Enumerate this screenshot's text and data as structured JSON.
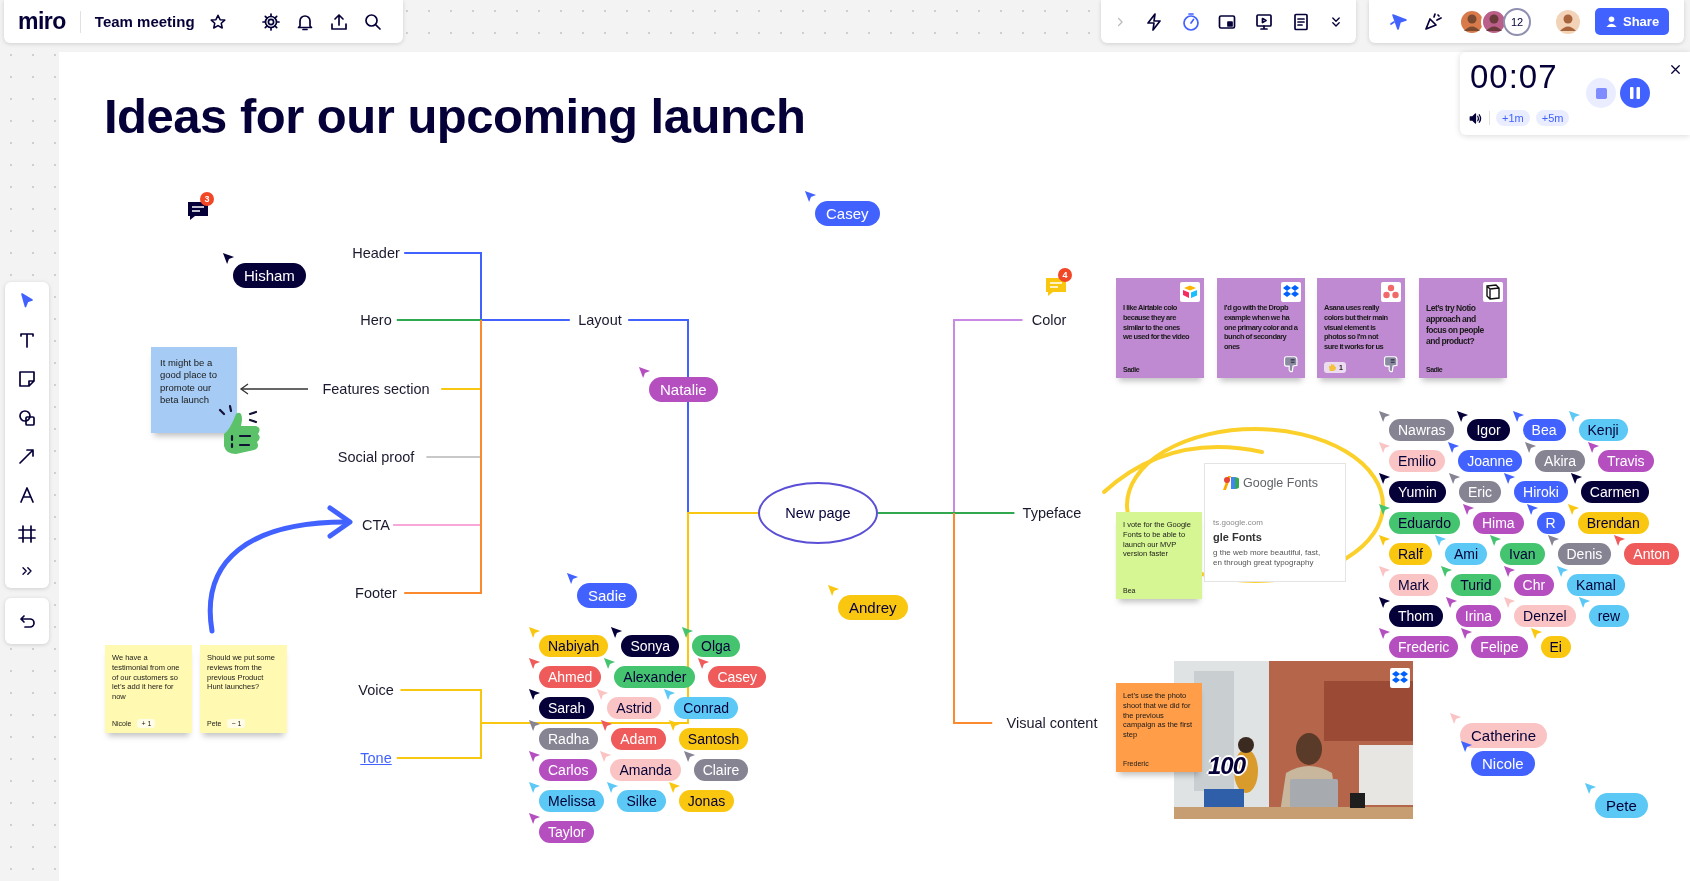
{
  "topbar": {
    "logo": "miro",
    "board_title": "Team meeting",
    "collaborator_count": "12",
    "share_label": "Share"
  },
  "timer": {
    "time": "00:07",
    "add_buttons": [
      "+1m",
      "+5m"
    ]
  },
  "board": {
    "title": "Ideas for our upcoming launch"
  },
  "mind_map": {
    "root": "New page",
    "children": [
      {
        "label": "Layout",
        "color": "#4262ff",
        "kind": "text",
        "children": [
          {
            "label": "Header",
            "color": "#4262ff"
          },
          {
            "label": "Hero",
            "color": "#2fa84f"
          },
          {
            "label": "Features section",
            "color": "#fac710"
          },
          {
            "label": "Social proof",
            "color": "#c8c8c8"
          },
          {
            "label": "CTA",
            "color": "#f7a8d8"
          },
          {
            "label": "Footer",
            "color": "#fa8a2d"
          }
        ]
      },
      {
        "label": "Voice",
        "color": "#fac710",
        "kind": "text"
      },
      {
        "label": "Tone",
        "color": "#fac710",
        "kind": "link"
      },
      {
        "label": "Color",
        "color": "#c98ae6",
        "kind": "text"
      },
      {
        "label": "Typeface",
        "color": "#2fa84f",
        "kind": "text"
      },
      {
        "label": "Visual content",
        "color": "#fa8a2d",
        "kind": "text"
      }
    ]
  },
  "comments": [
    {
      "count": "3",
      "color": "#050038"
    },
    {
      "count": "4",
      "color": "#fac710"
    }
  ],
  "sticky_notes": [
    {
      "text": "It might be a good place to promote our beta launch",
      "color": "#a6ccf5"
    },
    {
      "text": "We have a testimonial from one of our customers so let’s add it here for now",
      "author": "Nicole",
      "color": "#fff9b1",
      "reaction": {
        "kind": "vote",
        "sign": "+",
        "count": "1"
      }
    },
    {
      "text": "Should we put some reviews from the previous Product Hunt launches?",
      "author": "Pete",
      "color": "#fff9b1",
      "reaction": {
        "kind": "vote",
        "sign": "−",
        "count": "1"
      }
    },
    {
      "text": "I like Airtable colo\nbecause they are\nsimilar to the ones\nwe used for the video",
      "author": "Sadie",
      "color": "#c08ad2"
    },
    {
      "text": "I’d go with the Dropb\nexample when we ha\none primary color and a\nbunch of secondary ones",
      "color": "#c08ad2"
    },
    {
      "text": "Asana uses really\ncolors but their main\nvisual element is\nphotos so I’m not\nsure it works for us",
      "color": "#c08ad2",
      "reaction": {
        "kind": "emoji",
        "count": "1"
      }
    },
    {
      "text": "Let’s try Notio\napproach and\nfocus on people\nand product?",
      "author": "Sadie",
      "color": "#c08ad2"
    },
    {
      "text": "I vote for the Google Fonts to be able to launch our MVP version faster",
      "author": "Bea",
      "color": "#d5f692"
    },
    {
      "text": "Let’s use the photo shoot that we did for the previous campaign as the first step",
      "author": "Frederic",
      "color": "#ff9d48"
    }
  ],
  "link_preview": {
    "brand": "Google Fonts",
    "url": "ts.google.com",
    "title": "gle Fonts",
    "description": "g the web more beautiful, fast,\nen through great typography"
  },
  "photo": {
    "kind": "picture",
    "sticker": "100"
  },
  "cursors": [
    {
      "name": "Hisham",
      "color": "#050038"
    },
    {
      "name": "Casey",
      "color": "#4262ff"
    },
    {
      "name": "Natalie",
      "color": "#b54fc0"
    },
    {
      "name": "Sadie",
      "color": "#4262ff"
    },
    {
      "name": "Andrey",
      "color": "#fac710"
    },
    {
      "name": "Catherine",
      "color": "#fbc4c4"
    },
    {
      "name": "Nicole",
      "color": "#4262ff"
    },
    {
      "name": "Pete",
      "color": "#5bc8f5"
    }
  ],
  "cursor_clusters": [
    {
      "cursors": [
        {
          "name": "Nabiyah",
          "color": "#fac710"
        },
        {
          "name": "Sonya",
          "color": "#050038"
        },
        {
          "name": "Olga",
          "color": "#45c46f"
        },
        {
          "name": "Ahmed",
          "color": "#ef5b5b"
        },
        {
          "name": "Alexander",
          "color": "#45c46f"
        },
        {
          "name": "Casey",
          "color": "#ef5b5b"
        },
        {
          "name": "Sarah",
          "color": "#050038"
        },
        {
          "name": "Astrid",
          "color": "#fbc4c4"
        },
        {
          "name": "Conrad",
          "color": "#5bc8f5"
        },
        {
          "name": "Radha",
          "color": "#868393"
        },
        {
          "name": "Adam",
          "color": "#ef5b5b"
        },
        {
          "name": "Santosh",
          "color": "#fac710"
        },
        {
          "name": "Carlos",
          "color": "#b54fc0"
        },
        {
          "name": "Amanda",
          "color": "#fbc4c4"
        },
        {
          "name": "Claire",
          "color": "#868393"
        },
        {
          "name": "Melissa",
          "color": "#5bc8f5"
        },
        {
          "name": "Silke",
          "color": "#5bc8f5"
        },
        {
          "name": "Jonas",
          "color": "#fac710"
        },
        {
          "name": "Taylor",
          "color": "#b54fc0"
        }
      ]
    },
    {
      "cursors": [
        {
          "name": "Nawras",
          "color": "#868393"
        },
        {
          "name": "Igor",
          "color": "#050038"
        },
        {
          "name": "Bea",
          "color": "#4262ff"
        },
        {
          "name": "Kenji",
          "color": "#5bc8f5"
        },
        {
          "name": "Emilio",
          "color": "#fbc4c4"
        },
        {
          "name": "Joanne",
          "color": "#4262ff"
        },
        {
          "name": "Akira",
          "color": "#868393"
        },
        {
          "name": "Travis",
          "color": "#b54fc0"
        },
        {
          "name": "Yumin",
          "color": "#050038"
        },
        {
          "name": "Eric",
          "color": "#868393"
        },
        {
          "name": "Hiroki",
          "color": "#4262ff"
        },
        {
          "name": "Carmen",
          "color": "#050038"
        },
        {
          "name": "Eduardo",
          "color": "#45c46f"
        },
        {
          "name": "Hima",
          "color": "#b54fc0"
        },
        {
          "name": "R",
          "color": "#4262ff"
        },
        {
          "name": "Brendan",
          "color": "#fac710"
        },
        {
          "name": "Ralf",
          "color": "#fac710"
        },
        {
          "name": "Ami",
          "color": "#5bc8f5"
        },
        {
          "name": "Ivan",
          "color": "#45c46f"
        },
        {
          "name": "Denis",
          "color": "#868393"
        },
        {
          "name": "Anton",
          "color": "#ef5b5b"
        },
        {
          "name": "Mark",
          "color": "#fbc4c4"
        },
        {
          "name": "Turid",
          "color": "#45c46f"
        },
        {
          "name": "Chr",
          "color": "#b54fc0"
        },
        {
          "name": "Kamal",
          "color": "#5bc8f5"
        },
        {
          "name": "Thom",
          "color": "#050038"
        },
        {
          "name": "Irina",
          "color": "#b54fc0"
        },
        {
          "name": "Denzel",
          "color": "#fbc4c4"
        },
        {
          "name": "rew",
          "color": "#5bc8f5"
        },
        {
          "name": "Frederic",
          "color": "#b54fc0"
        },
        {
          "name": "Felipe",
          "color": "#b54fc0"
        },
        {
          "name": "Ei",
          "color": "#fac710"
        }
      ]
    }
  ]
}
